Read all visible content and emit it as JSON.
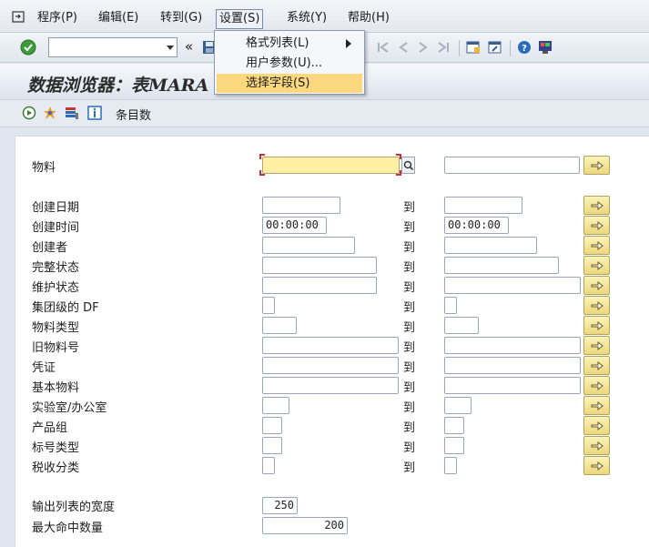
{
  "menubar": {
    "items": [
      {
        "label": "程序(P)"
      },
      {
        "label": "编辑(E)"
      },
      {
        "label": "转到(G)"
      },
      {
        "label": "设置(S)"
      },
      {
        "label": "系统(Y)"
      },
      {
        "label": "帮助(H)"
      }
    ]
  },
  "toolbar": {
    "command_field_value": "",
    "collapse_glyph": "«"
  },
  "dropdown": {
    "items": [
      {
        "label": "格式列表(L)",
        "has_submenu": true
      },
      {
        "label": "用户参数(U)..."
      },
      {
        "label": "选择字段(S)",
        "highlighted": true
      }
    ]
  },
  "title": "数据浏览器：表MARA",
  "app_toolbar": {
    "entries_label": "条目数"
  },
  "fields": {
    "material": {
      "label": "物料",
      "low": "",
      "high": ""
    },
    "rows": [
      {
        "label": "创建日期",
        "to": "到",
        "low": "",
        "high": ""
      },
      {
        "label": "创建时间",
        "to": "到",
        "low": "00:00:00",
        "high": "00:00:00"
      },
      {
        "label": "创建者",
        "to": "到",
        "low": "",
        "high": ""
      },
      {
        "label": "完整状态",
        "to": "到",
        "low": "",
        "high": ""
      },
      {
        "label": "维护状态",
        "to": "到",
        "low": "",
        "high": ""
      },
      {
        "label": "集团级的 DF",
        "to": "到",
        "low": "",
        "high": ""
      },
      {
        "label": "物料类型",
        "to": "到",
        "low": "",
        "high": ""
      },
      {
        "label": "旧物料号",
        "to": "到",
        "low": "",
        "high": ""
      },
      {
        "label": "凭证",
        "to": "到",
        "low": "",
        "high": ""
      },
      {
        "label": "基本物料",
        "to": "到",
        "low": "",
        "high": ""
      },
      {
        "label": "实验室/办公室",
        "to": "到",
        "low": "",
        "high": ""
      },
      {
        "label": "产品组",
        "to": "到",
        "low": "",
        "high": ""
      },
      {
        "label": "标号类型",
        "to": "到",
        "low": "",
        "high": ""
      },
      {
        "label": "税收分类",
        "to": "到",
        "low": "",
        "high": ""
      }
    ]
  },
  "output": {
    "width_label": "输出列表的宽度",
    "width_value": "250",
    "max_hits_label": "最大命中数量",
    "max_hits_value": "200"
  },
  "colors": {
    "highlight": "#fbd87d",
    "focus_field": "#fff0a6",
    "arrow_button": "#ecd77c"
  }
}
